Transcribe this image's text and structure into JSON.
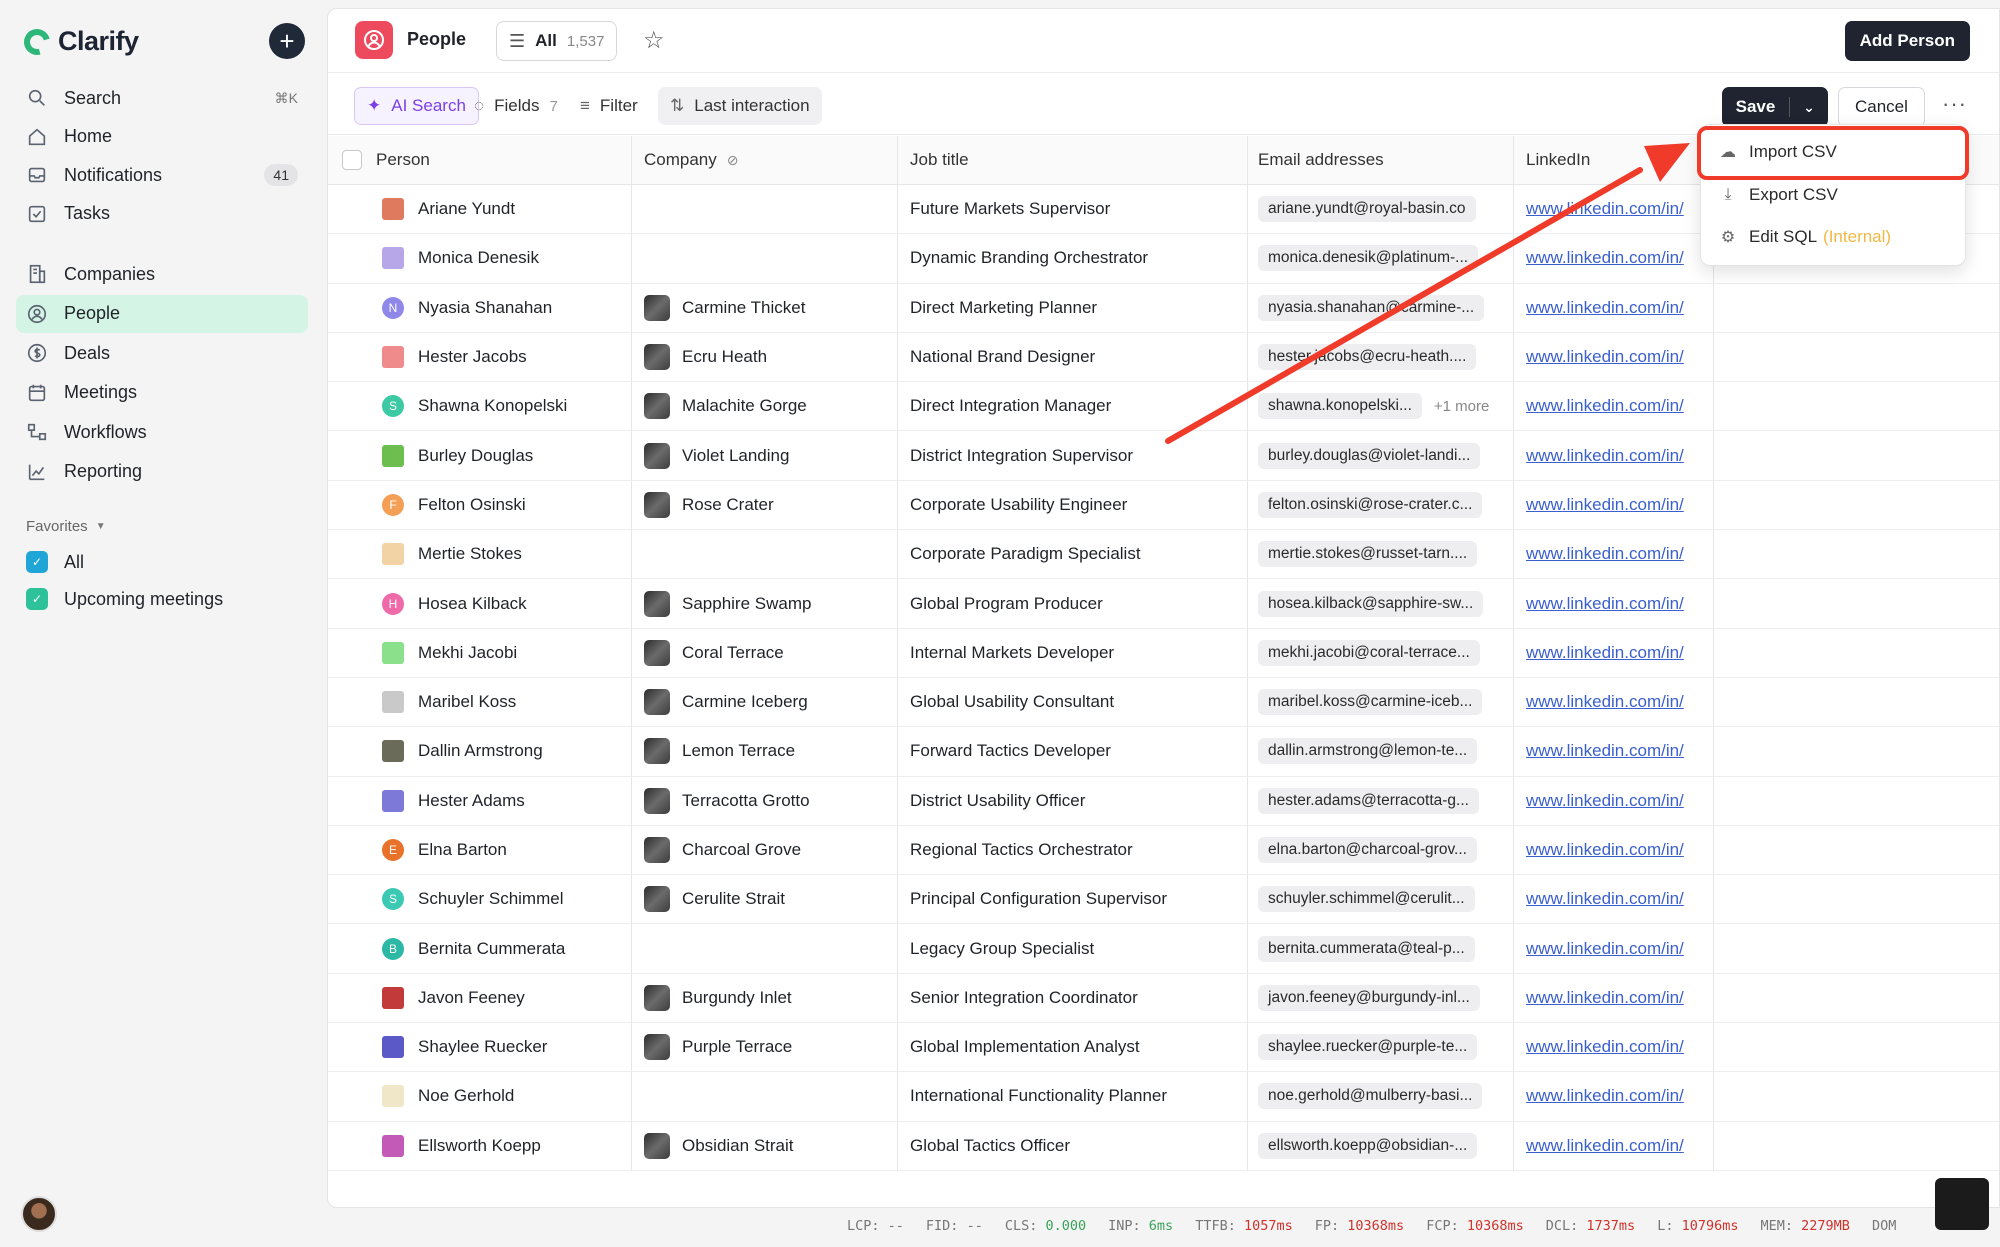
{
  "app": {
    "name": "Clarify"
  },
  "sidebar": {
    "nav": [
      {
        "label": "Search",
        "icon": "search-icon",
        "shortcut": "⌘K"
      },
      {
        "label": "Home",
        "icon": "home-icon"
      },
      {
        "label": "Notifications",
        "icon": "inbox-icon",
        "badge": "41"
      },
      {
        "label": "Tasks",
        "icon": "checkbox-icon"
      }
    ],
    "nav2": [
      {
        "label": "Companies",
        "icon": "building-icon"
      },
      {
        "label": "People",
        "icon": "person-circle-icon",
        "active": true
      },
      {
        "label": "Deals",
        "icon": "dollar-icon"
      },
      {
        "label": "Meetings",
        "icon": "calendar-icon"
      },
      {
        "label": "Workflows",
        "icon": "workflow-icon"
      },
      {
        "label": "Reporting",
        "icon": "chart-icon"
      }
    ],
    "favorites_label": "Favorites",
    "favorites": [
      {
        "label": "All",
        "color": "#1fa6d6"
      },
      {
        "label": "Upcoming meetings",
        "color": "#2dc29a"
      }
    ]
  },
  "header": {
    "title": "People",
    "view_name": "All",
    "view_count": "1,537",
    "add_button": "Add Person"
  },
  "toolbar": {
    "ai_search": "AI Search",
    "fields": "Fields",
    "fields_count": "7",
    "filter": "Filter",
    "sort": "Last interaction",
    "save": "Save",
    "cancel": "Cancel"
  },
  "table": {
    "columns": [
      "Person",
      "Company",
      "Job title",
      "Email addresses",
      "LinkedIn"
    ],
    "rows": [
      {
        "person": "Ariane Yundt",
        "company": "",
        "job": "Future Markets Supervisor",
        "email": "ariane.yundt@royal-basin.co",
        "linkedin": "www.linkedin.com/in/",
        "av": "#e07a5f"
      },
      {
        "person": "Monica Denesik",
        "company": "",
        "job": "Dynamic Branding Orchestrator",
        "email": "monica.denesik@platinum-...",
        "linkedin": "www.linkedin.com/in/",
        "av": "#b7a6e8"
      },
      {
        "person": "Nyasia Shanahan",
        "company": "Carmine Thicket",
        "job": "Direct Marketing Planner",
        "email": "nyasia.shanahan@carmine-...",
        "linkedin": "www.linkedin.com/in/",
        "av": "#8f88e8",
        "initial": "N"
      },
      {
        "person": "Hester Jacobs",
        "company": "Ecru Heath",
        "job": "National Brand Designer",
        "email": "hester.jacobs@ecru-heath....",
        "linkedin": "www.linkedin.com/in/",
        "av": "#ef8b8b"
      },
      {
        "person": "Shawna Konopelski",
        "company": "Malachite Gorge",
        "job": "Direct Integration Manager",
        "email": "shawna.konopelski...",
        "more": "+1 more",
        "linkedin": "www.linkedin.com/in/",
        "av": "#3cc9a3",
        "initial": "S"
      },
      {
        "person": "Burley Douglas",
        "company": "Violet Landing",
        "job": "District Integration Supervisor",
        "email": "burley.douglas@violet-landi...",
        "linkedin": "www.linkedin.com/in/",
        "av": "#6cbf4f"
      },
      {
        "person": "Felton Osinski",
        "company": "Rose Crater",
        "job": "Corporate Usability Engineer",
        "email": "felton.osinski@rose-crater.c...",
        "linkedin": "www.linkedin.com/in/",
        "av": "#f3a056",
        "initial": "F"
      },
      {
        "person": "Mertie Stokes",
        "company": "",
        "job": "Corporate Paradigm Specialist",
        "email": "mertie.stokes@russet-tarn....",
        "linkedin": "www.linkedin.com/in/",
        "av": "#f1d3a6"
      },
      {
        "person": "Hosea Kilback",
        "company": "Sapphire Swamp",
        "job": "Global Program Producer",
        "email": "hosea.kilback@sapphire-sw...",
        "linkedin": "www.linkedin.com/in/",
        "av": "#ef6aa8",
        "initial": "H"
      },
      {
        "person": "Mekhi Jacobi",
        "company": "Coral Terrace",
        "job": "Internal Markets Developer",
        "email": "mekhi.jacobi@coral-terrace...",
        "linkedin": "www.linkedin.com/in/",
        "av": "#8be08b"
      },
      {
        "person": "Maribel Koss",
        "company": "Carmine Iceberg",
        "job": "Global Usability Consultant",
        "email": "maribel.koss@carmine-iceb...",
        "linkedin": "www.linkedin.com/in/",
        "av": "#c9c9c9"
      },
      {
        "person": "Dallin Armstrong",
        "company": "Lemon Terrace",
        "job": "Forward Tactics Developer",
        "email": "dallin.armstrong@lemon-te...",
        "linkedin": "www.linkedin.com/in/",
        "av": "#6b6b5a"
      },
      {
        "person": "Hester Adams",
        "company": "Terracotta Grotto",
        "job": "District Usability Officer",
        "email": "hester.adams@terracotta-g...",
        "linkedin": "www.linkedin.com/in/",
        "av": "#7c79d8"
      },
      {
        "person": "Elna Barton",
        "company": "Charcoal Grove",
        "job": "Regional Tactics Orchestrator",
        "email": "elna.barton@charcoal-grov...",
        "linkedin": "www.linkedin.com/in/",
        "av": "#e8722a",
        "initial": "E"
      },
      {
        "person": "Schuyler Schimmel",
        "company": "Cerulite Strait",
        "job": "Principal Configuration Supervisor",
        "email": "schuyler.schimmel@cerulit...",
        "linkedin": "www.linkedin.com/in/",
        "av": "#3cc9b3",
        "initial": "S"
      },
      {
        "person": "Bernita Cummerata",
        "company": "",
        "job": "Legacy Group Specialist",
        "email": "bernita.cummerata@teal-p...",
        "linkedin": "www.linkedin.com/in/",
        "av": "#2bb8a4",
        "initial": "B"
      },
      {
        "person": "Javon Feeney",
        "company": "Burgundy Inlet",
        "job": "Senior Integration Coordinator",
        "email": "javon.feeney@burgundy-inl...",
        "linkedin": "www.linkedin.com/in/",
        "av": "#c23a3a"
      },
      {
        "person": "Shaylee Ruecker",
        "company": "Purple Terrace",
        "job": "Global Implementation Analyst",
        "email": "shaylee.ruecker@purple-te...",
        "linkedin": "www.linkedin.com/in/",
        "av": "#5b58c8"
      },
      {
        "person": "Noe Gerhold",
        "company": "",
        "job": "International Functionality Planner",
        "email": "noe.gerhold@mulberry-basi...",
        "linkedin": "www.linkedin.com/in/",
        "av": "#f0e6c8"
      },
      {
        "person": "Ellsworth Koepp",
        "company": "Obsidian Strait",
        "job": "Global Tactics Officer",
        "email": "ellsworth.koepp@obsidian-...",
        "linkedin": "www.linkedin.com/in/",
        "av": "#c45ab8"
      }
    ]
  },
  "dropdown": {
    "import": "Import CSV",
    "export": "Export CSV",
    "edit_sql": "Edit SQL",
    "internal": "(Internal)"
  },
  "metrics": [
    {
      "label": "LCP:",
      "value": "--",
      "status": "neutral"
    },
    {
      "label": "FID:",
      "value": "--",
      "status": "neutral"
    },
    {
      "label": "CLS:",
      "value": "0.000",
      "status": "ok"
    },
    {
      "label": "INP:",
      "value": "6ms",
      "status": "ok"
    },
    {
      "label": "TTFB:",
      "value": "1057ms",
      "status": "bad"
    },
    {
      "label": "FP:",
      "value": "10368ms",
      "status": "bad"
    },
    {
      "label": "FCP:",
      "value": "10368ms",
      "status": "bad"
    },
    {
      "label": "DCL:",
      "value": "1737ms",
      "status": "bad"
    },
    {
      "label": "L:",
      "value": "10796ms",
      "status": "bad"
    },
    {
      "label": "MEM:",
      "value": "2279MB",
      "status": "bad"
    },
    {
      "label": "DOM",
      "value": "",
      "status": "neutral"
    }
  ],
  "colors": {
    "accent": "#2db87a",
    "active_bg": "#d4f5e6",
    "people_icon": "#ee4a5e",
    "annotation": "#f03a2a"
  }
}
